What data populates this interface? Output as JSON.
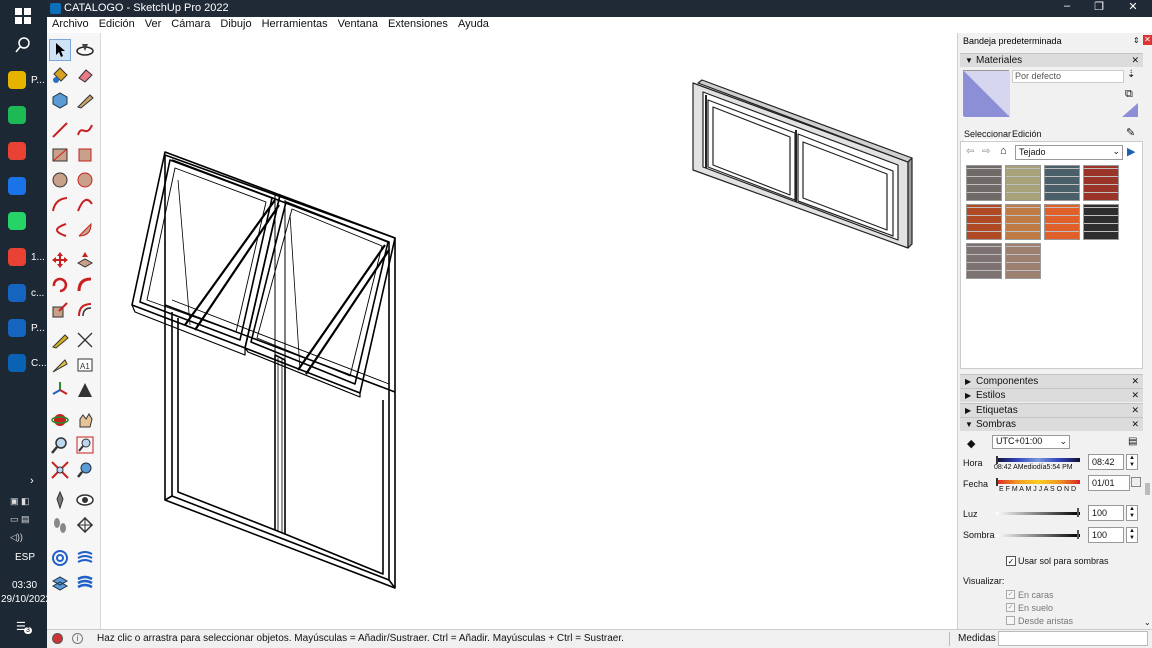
{
  "window": {
    "title": "CATALOGO - SketchUp Pro 2022"
  },
  "menu": [
    "Archivo",
    "Edición",
    "Ver",
    "Cámara",
    "Dibujo",
    "Herramientas",
    "Ventana",
    "Extensiones",
    "Ayuda"
  ],
  "taskbar": {
    "items": [
      {
        "label": "P...",
        "color": "#e6b400"
      },
      {
        "label": "",
        "color": "#1db954"
      },
      {
        "label": "",
        "color": "#e94235"
      },
      {
        "label": "",
        "color": "#1a73e8"
      },
      {
        "label": "",
        "color": "#25d366"
      },
      {
        "label": "1...",
        "color": "#e94235"
      },
      {
        "label": "c...",
        "color": "#1565c0"
      },
      {
        "label": "P...",
        "color": "#1565c0"
      },
      {
        "label": "C...",
        "color": "#0a62b4"
      }
    ],
    "lang": "ESP",
    "time": "03:30",
    "date": "29/10/2022",
    "notif": "3"
  },
  "status": {
    "hint": "Haz clic o arrastra para seleccionar objetos. Mayúsculas = Añadir/Sustraer. Ctrl = Añadir. Mayúsculas + Ctrl = Sustraer.",
    "medidas": "Medidas"
  },
  "tray": {
    "title": "Bandeja predeterminada",
    "materials": {
      "header": "Materiales",
      "default_name": "Por defecto",
      "tab_select": "Seleccionar",
      "tab_edit": "Edición",
      "library": "Tejado",
      "swatch_colors": [
        "#6f6a68",
        "#a7a27a",
        "#4a5f6a",
        "#9c3328",
        "#b04a25",
        "#c07a45",
        "#e0602a",
        "#2e2e2e",
        "#7c7272",
        "#9c8070"
      ]
    },
    "collapsed_sections": [
      "Componentes",
      "Estilos",
      "Etiquetas"
    ],
    "shadows": {
      "header": "Sombras",
      "timezone": "UTC+01:00",
      "hora_label": "Hora",
      "hora_scale": "08:42 AMediodía5:54 PM",
      "hora_value": "08:42",
      "fecha_label": "Fecha",
      "fecha_scale": "E F M A M J J A S O N D",
      "fecha_value": "01/01",
      "luz_label": "Luz",
      "luz_value": "100",
      "sombra_label": "Sombra",
      "sombra_value": "100",
      "use_sun": "Usar sol para sombras",
      "visualizar": "Visualizar:",
      "on_faces": "En caras",
      "on_ground": "En suelo",
      "from_edges": "Desde aristas"
    }
  }
}
